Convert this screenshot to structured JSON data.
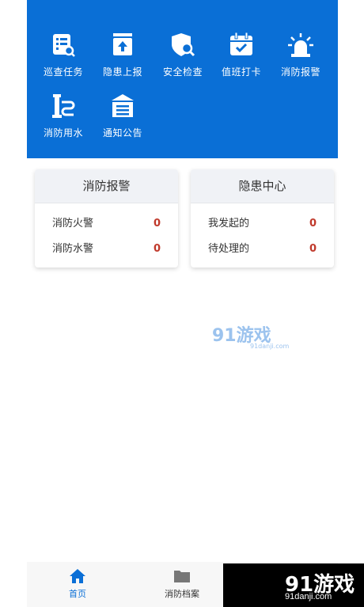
{
  "menu": {
    "items": [
      {
        "label": "巡查任务",
        "icon": "checklist-search-icon"
      },
      {
        "label": "隐患上报",
        "icon": "upload-box-icon"
      },
      {
        "label": "安全检查",
        "icon": "shield-search-icon"
      },
      {
        "label": "值班打卡",
        "icon": "calendar-check-icon"
      },
      {
        "label": "消防报警",
        "icon": "alarm-light-icon"
      },
      {
        "label": "消防用水",
        "icon": "hydrant-icon"
      },
      {
        "label": "通知公告",
        "icon": "notice-board-icon"
      }
    ]
  },
  "cards": {
    "alarm": {
      "title": "消防报警",
      "rows": [
        {
          "label": "消防火警",
          "value": "0"
        },
        {
          "label": "消防水警",
          "value": "0"
        }
      ]
    },
    "hazard": {
      "title": "隐患中心",
      "rows": [
        {
          "label": "我发起的",
          "value": "0"
        },
        {
          "label": "待处理的",
          "value": "0"
        }
      ]
    }
  },
  "watermark": {
    "brand": "91游戏",
    "site": "91danji.com"
  },
  "bottom_nav": {
    "home": {
      "label": "首页",
      "icon": "home-icon"
    },
    "archive": {
      "label": "消防档案",
      "icon": "folder-icon"
    }
  },
  "brand_banner": {
    "logo": "91游戏",
    "site": "91danji.com"
  },
  "colors": {
    "primary": "#0a6fd6",
    "value": "#c0392b",
    "card_header": "#f0f2f6"
  }
}
